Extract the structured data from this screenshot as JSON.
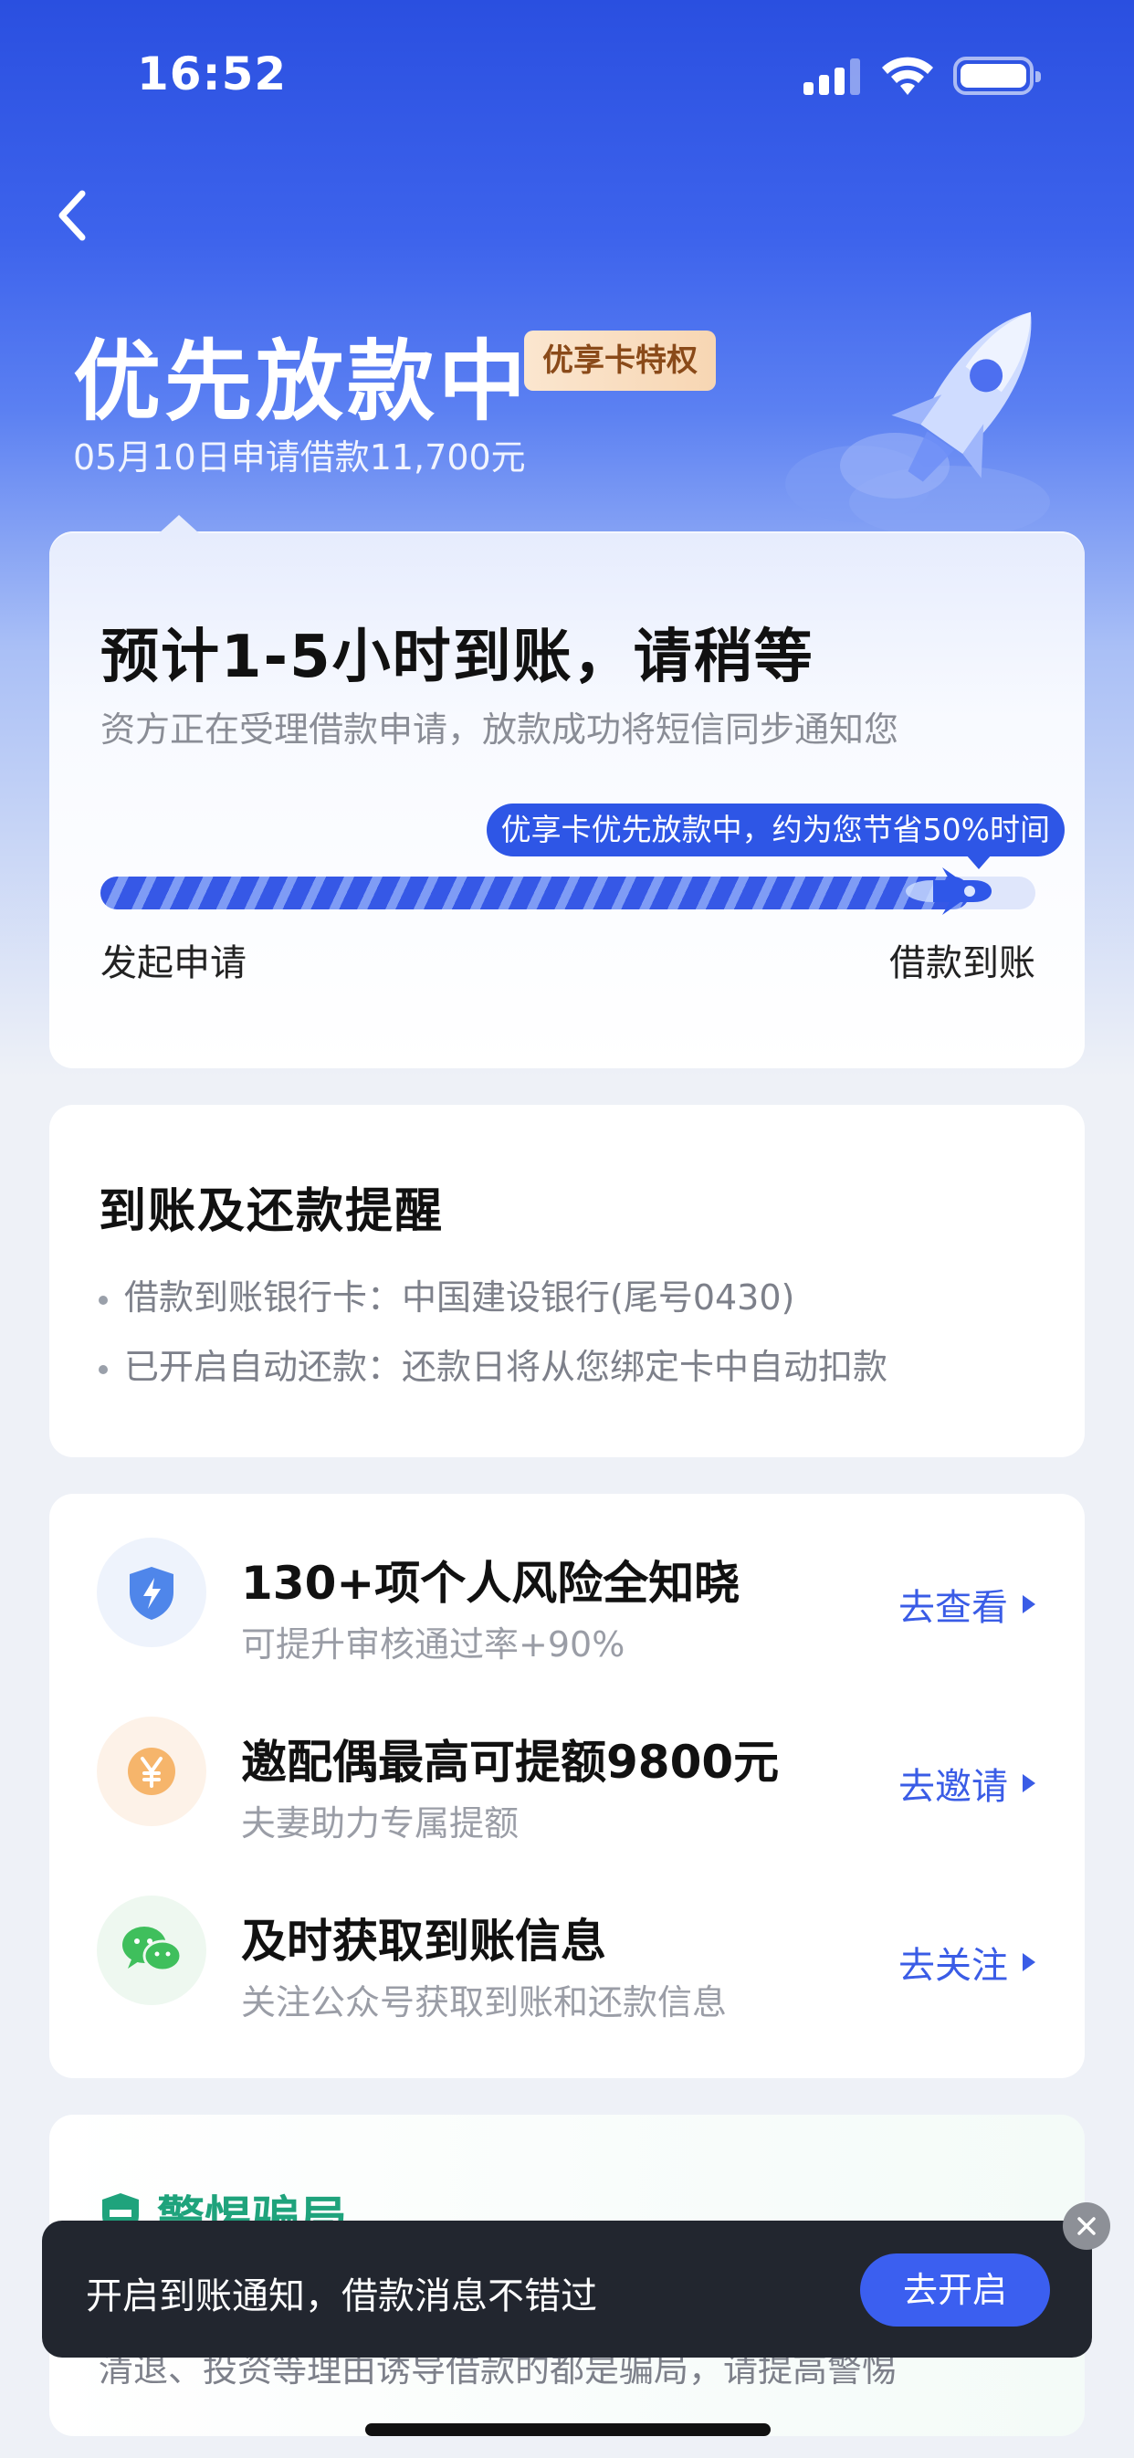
{
  "status_bar": {
    "time": "16:52"
  },
  "hero": {
    "title": "优先放款中",
    "badge": "优享卡特权",
    "subtitle": "05月10日申请借款11,700元"
  },
  "progress_card": {
    "title": "预计1-5小时到账，请稍等",
    "subtitle": "资方正在受理借款申请，放款成功将短信同步通知您",
    "bubble": "优享卡优先放款中，约为您节省50%时间",
    "progress_fraction": 0.93,
    "start_label": "发起申请",
    "end_label": "借款到账"
  },
  "reminder": {
    "title": "到账及还款提醒",
    "lines": [
      "借款到账银行卡：中国建设银行(尾号0430)",
      "已开启自动还款：还款日将从您绑定卡中自动扣款"
    ]
  },
  "tasks": [
    {
      "title": "130+项个人风险全知晓",
      "subtitle": "可提升审核通过率+90%",
      "action": "去查看",
      "icon": "shield-lightning-icon"
    },
    {
      "title": "邀配偶最高可提额9800元",
      "subtitle": "夫妻助力专属提额",
      "action": "去邀请",
      "icon": "yen-coin-icon"
    },
    {
      "title": "及时获取到账信息",
      "subtitle": "关注公众号获取到账和还款信息",
      "action": "去关注",
      "icon": "wechat-icon"
    }
  ],
  "fraud": {
    "title": "警惕骗局",
    "text": "清退、投资等理由诱导借款的都是骗局，请提高警惕"
  },
  "toast": {
    "text": "开启到账通知，借款消息不错过",
    "button": "去开启"
  },
  "colors": {
    "primary": "#3a5ce6",
    "hero_top": "#2a4fe0",
    "fraud_green": "#1fa37c",
    "badge_text": "#8a4a19"
  }
}
